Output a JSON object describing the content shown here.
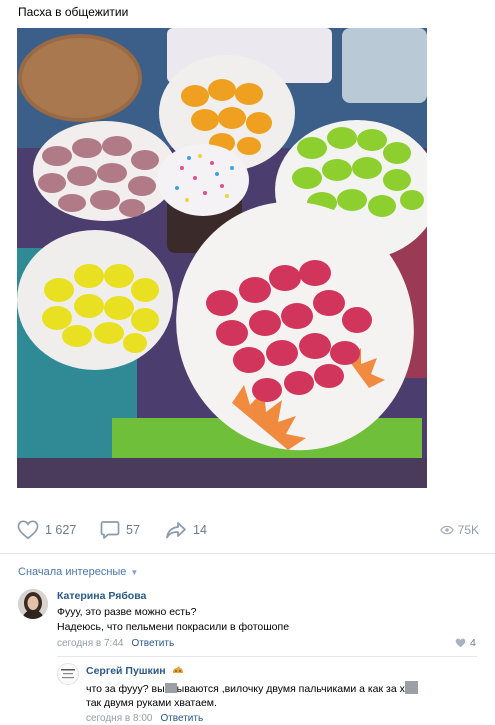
{
  "post": {
    "title": "Пасха в общежитии"
  },
  "actions": {
    "likes": "1 627",
    "comments": "57",
    "shares": "14",
    "views": "75K"
  },
  "comments": {
    "sort_label": "Сначала интересные",
    "items": [
      {
        "author": "Катерина Рябова",
        "line1": "Фууу, это разве можно есть?",
        "line2": "Надеюсь, что пельмени покрасили в фотошопе",
        "time": "сегодня в 7:44",
        "reply": "Ответить",
        "likes": "4"
      },
      {
        "author": "Сергей Пушкин",
        "line1_a": "что за фууу? вы",
        "line1_b": "ываются ,вилочку двумя пальчиками а как за х",
        "line2": "так двумя руками хватаем.",
        "time": "сегодня в 8:00",
        "reply": "Ответить"
      }
    ]
  },
  "colors": {
    "link": "#2a5885",
    "accent": "#4a76a8",
    "muted": "#939ca8"
  },
  "icons": [
    "heart-icon",
    "comment-icon",
    "share-icon",
    "eye-icon",
    "chevron-down-icon"
  ]
}
